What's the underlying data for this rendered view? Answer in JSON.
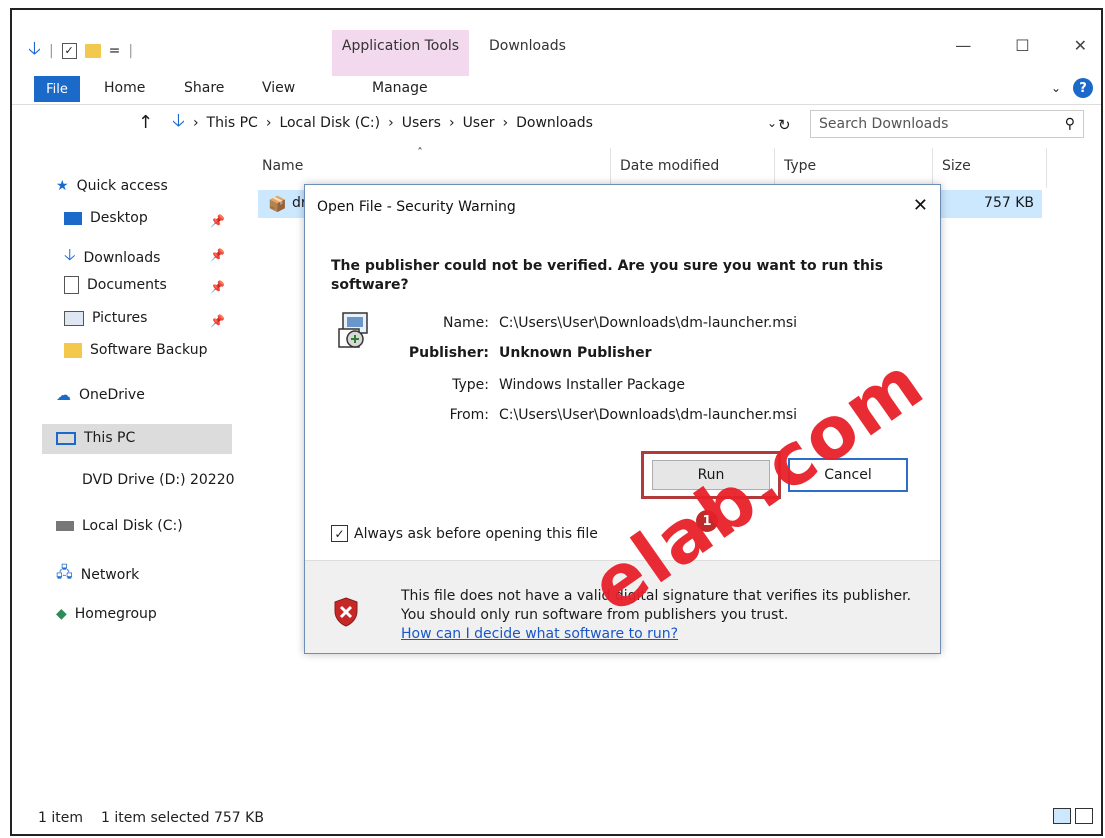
{
  "qat": {
    "sep": "|",
    "dropdown": "="
  },
  "ribbon": {
    "context_tab": "Application Tools",
    "window_title": "Downloads",
    "tabs": {
      "file": "File",
      "home": "Home",
      "share": "Share",
      "view": "View",
      "manage": "Manage"
    }
  },
  "address": {
    "crumbs": [
      "This PC",
      "Local Disk (C:)",
      "Users",
      "User",
      "Downloads"
    ],
    "search_placeholder": "Search Downloads"
  },
  "columns": {
    "name": "Name",
    "date": "Date modified",
    "type": "Type",
    "size": "Size"
  },
  "file_row": {
    "name_partial": "dr",
    "size": "757 KB"
  },
  "nav": {
    "quick_access": "Quick access",
    "desktop": "Desktop",
    "downloads": "Downloads",
    "documents": "Documents",
    "pictures": "Pictures",
    "software_backup": "Software Backup",
    "onedrive": "OneDrive",
    "this_pc": "This PC",
    "dvd": "DVD Drive (D:) 20220",
    "local_disk": "Local Disk (C:)",
    "network": "Network",
    "homegroup": "Homegroup"
  },
  "status": {
    "count": "1 item",
    "selected": "1 item selected  757 KB"
  },
  "dialog": {
    "title": "Open File - Security Warning",
    "warning": "The publisher could not be verified.  Are you sure you want to run this software?",
    "name_key": "Name:",
    "name_val": "C:\\Users\\User\\Downloads\\dm-launcher.msi",
    "publisher_key": "Publisher:",
    "publisher_val": "Unknown Publisher",
    "type_key": "Type:",
    "type_val": "Windows Installer Package",
    "from_key": "From:",
    "from_val": "C:\\Users\\User\\Downloads\\dm-launcher.msi",
    "run": "Run",
    "cancel": "Cancel",
    "badge": "1",
    "checkbox": "Always ask before opening this file",
    "footer_text": "This file does not have a valid digital signature that verifies its publisher.  You should only run software from publishers you trust.",
    "footer_link": "How can I decide what software to run?"
  },
  "watermark": "elab.com",
  "colors": {
    "accent": "#1b6ac9",
    "highlight": "#b23a3a",
    "watermark": "#e8202a"
  }
}
